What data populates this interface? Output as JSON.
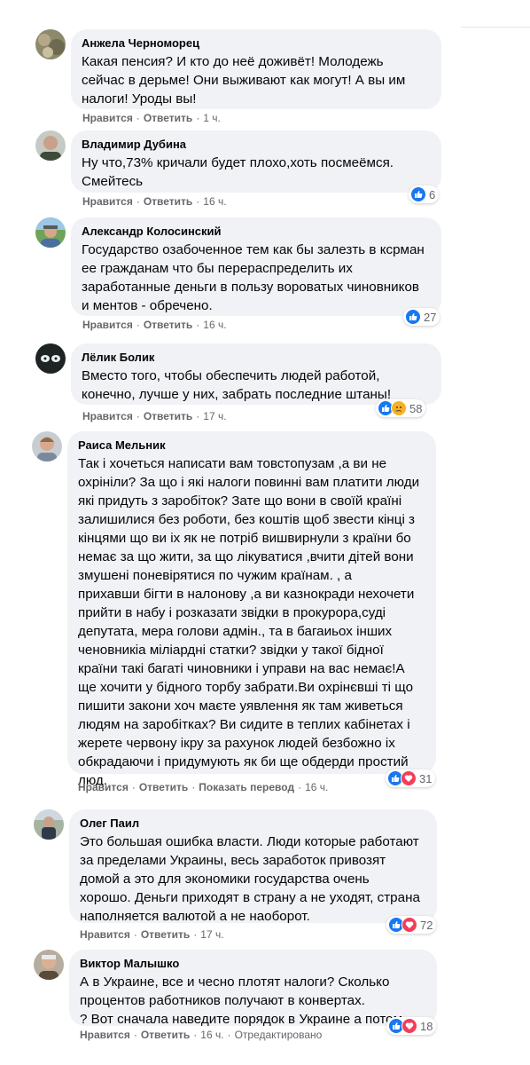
{
  "actions": {
    "like": "Нравится",
    "reply": "Ответить",
    "translate": "Показать перевод",
    "edited": "Отредактировано"
  },
  "comments": [
    {
      "author": "Анжела Черноморец",
      "text": "Какая пенсия? И кто до неё доживёт! Молодежь\nсейчас в дерьме! Они выживают как могут! А вы им\nналоги! Уроды вы!",
      "time": "1 ч.",
      "reactions": [],
      "count": ""
    },
    {
      "author": "Владимир Дубина",
      "text": "Ну что,73% кричали будет плохо,хоть посмеёмся.\nСмейтесь",
      "time": "16 ч.",
      "reactions": [
        "like"
      ],
      "count": "6"
    },
    {
      "author": "Александр Колосинский",
      "text": "Государство озабоченное тем как бы залезть в ксрман\nее гражданам что бы перераспределить их\nзаработанные деньги в пользу вороватых чиновников\nи ментов - обречено.",
      "time": "16 ч.",
      "reactions": [
        "like"
      ],
      "count": "27"
    },
    {
      "author": "Лёлик Болик",
      "text": "Вместо того, чтобы обеспечить людей работой,\nконечно, лучше у них, забрать последние штаны!",
      "time": "17 ч.",
      "reactions": [
        "like",
        "sad"
      ],
      "count": "58"
    },
    {
      "author": "Раиса Мельник",
      "text": "Так і хочеться написати вам товстопузам ,а ви не\nохрініли? За що і які налоги повинні вам платити люди\nякі придуть з заробіток? Зате що вони в своїй країні\nзалишилися без роботи, без коштів щоб звести кінці з\nкінцями що ви іх як не потріб вишвирнули з країни бо\nнемає за що жити, за що лікуватися ,вчити дітей вони\nзмушені поневірятися по чужим країнам. , а\nприхавши бігти в налонову ,а ви казнокради нехочети\nприйти в набу і розказати звідки в прокурора,суді\nдепутата, мера голови адмін., та в багаиьох інших\nченовникiа міліардні статки? звідки у такої бідної\nкраїни такі багаті чиновники і управи на вас немає!А\nще хочити у бідного торбу забрати.Ви охрінєвші ті що\nпишити закони хоч маєте уявлення як там живеться\nлюдям на заробітках? Ви сидите в теплих кабінетах і\nжерете червону ікру за рахунок людей безбожно іх\nобкрадаючи і придумують як би ще обдерди простий\nлюд.",
      "time": "16 ч.",
      "reactions": [
        "like",
        "love"
      ],
      "count": "31",
      "translate": true
    },
    {
      "author": "Олег Паил",
      "text": "Это большая ошибка власти. Люди которые работают\nза пределами Украины, весь заработок привозят\nдомой а это для экономики государства очень\nхорошо. Деньги приходят в страну а не уходят, страна\nнаполняется валютой а не наоборот.",
      "time": "17 ч.",
      "reactions": [
        "like",
        "love"
      ],
      "count": "72"
    },
    {
      "author": "Виктор Малышко",
      "text": "А в Украине, все и чесно плотят налоги? Сколько\nпроцентов работников получают в конвертах.\n? Вот сначала наведите порядок в Украине а потом.....",
      "time": "16 ч.",
      "reactions": [
        "like",
        "love"
      ],
      "count": "18",
      "edited": true
    }
  ],
  "colors": {
    "bubble": "#f0f2f5",
    "meta": "#65676b",
    "like": "#1877f2",
    "love": "#f33e58",
    "sad": "#f7b125"
  }
}
